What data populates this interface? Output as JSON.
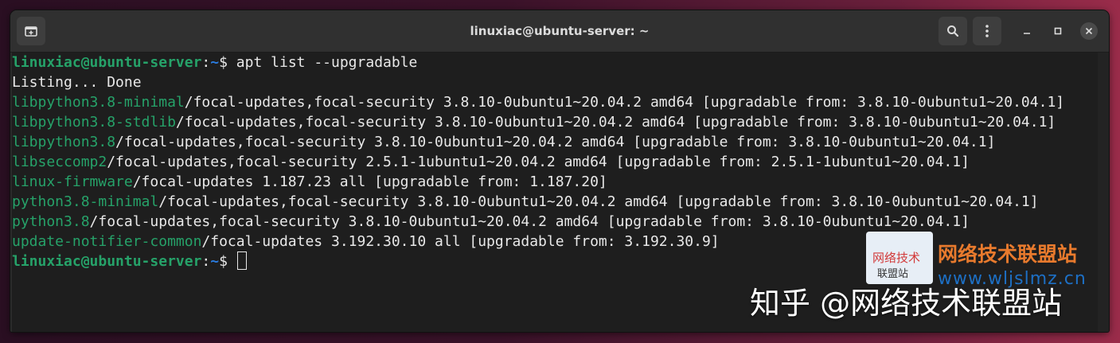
{
  "window": {
    "title": "linuxiac@ubuntu-server: ~",
    "buttons": {
      "new_tab_icon": "new-tab-icon",
      "search_icon": "search-icon",
      "menu_icon": "kebab-menu-icon",
      "minimize_icon": "minimize-icon",
      "maximize_icon": "maximize-icon",
      "close_icon": "close-icon"
    }
  },
  "terminal": {
    "prompt": {
      "user_host": "linuxiac@ubuntu-server",
      "sep": ":",
      "path": "~",
      "dollar": "$ "
    },
    "command": "apt list --upgradable",
    "status": "Listing... Done",
    "packages": [
      {
        "name": "libpython3.8-minimal",
        "rest": "/focal-updates,focal-security 3.8.10-0ubuntu1~20.04.2 amd64 [upgradable from: 3.8.10-0ubuntu1~20.04.1]"
      },
      {
        "name": "libpython3.8-stdlib",
        "rest": "/focal-updates,focal-security 3.8.10-0ubuntu1~20.04.2 amd64 [upgradable from: 3.8.10-0ubuntu1~20.04.1]"
      },
      {
        "name": "libpython3.8",
        "rest": "/focal-updates,focal-security 3.8.10-0ubuntu1~20.04.2 amd64 [upgradable from: 3.8.10-0ubuntu1~20.04.1]"
      },
      {
        "name": "libseccomp2",
        "rest": "/focal-updates,focal-security 2.5.1-1ubuntu1~20.04.2 amd64 [upgradable from: 2.5.1-1ubuntu1~20.04.1]"
      },
      {
        "name": "linux-firmware",
        "rest": "/focal-updates 1.187.23 all [upgradable from: 1.187.20]"
      },
      {
        "name": "python3.8-minimal",
        "rest": "/focal-updates,focal-security 3.8.10-0ubuntu1~20.04.2 amd64 [upgradable from: 3.8.10-0ubuntu1~20.04.1]"
      },
      {
        "name": "python3.8",
        "rest": "/focal-updates,focal-security 3.8.10-0ubuntu1~20.04.2 amd64 [upgradable from: 3.8.10-0ubuntu1~20.04.1]"
      },
      {
        "name": "update-notifier-common",
        "rest": "/focal-updates 3.192.30.10 all [upgradable from: 3.192.30.9]"
      }
    ]
  },
  "watermark": {
    "logo_line1": "网络技术",
    "logo_line2": "联盟站",
    "site_name": "网络技术联盟站",
    "site_url": "www.wljslmz.cn",
    "zhihu": "知乎 @网络技术联盟站"
  },
  "colors": {
    "terminal_bg": "#1e1e1e",
    "text": "#e8e8e8",
    "package_green": "#26a269",
    "path_blue": "#2a7bde",
    "titlebar": "#303030"
  }
}
